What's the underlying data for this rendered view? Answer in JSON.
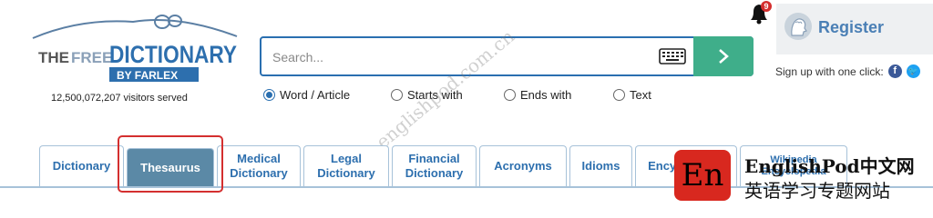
{
  "header": {
    "logo": {
      "line1": "THE",
      "line2": "FREE",
      "line3": "DICTIONARY",
      "line4": "BY FARLEX"
    },
    "visitors": "12,500,072,207 visitors served"
  },
  "search": {
    "placeholder": "Search...",
    "value": "",
    "go_icon": "chevron-right-icon",
    "keyboard_icon": "keyboard-icon"
  },
  "search_modes": [
    {
      "label": "Word / Article",
      "selected": true
    },
    {
      "label": "Starts with",
      "selected": false
    },
    {
      "label": "Ends with",
      "selected": false
    },
    {
      "label": "Text",
      "selected": false
    }
  ],
  "notifications": {
    "count": "9"
  },
  "account": {
    "register_label": "Register",
    "signup_text": "Sign up with one click:"
  },
  "tabs": [
    {
      "label": "Dictionary",
      "active": false
    },
    {
      "label": "Thesaurus",
      "active": true
    },
    {
      "label": "Medical Dictionary",
      "active": false
    },
    {
      "label": "Legal Dictionary",
      "active": false
    },
    {
      "label": "Financial Dictionary",
      "active": false
    },
    {
      "label": "Acronyms",
      "active": false
    },
    {
      "label": "Idioms",
      "active": false
    },
    {
      "label": "Encyclopedia",
      "active": false
    },
    {
      "label": "Wikipedia Encyclopedia",
      "active": false
    }
  ],
  "watermark": {
    "diagonal": "englishpod.com.cn",
    "logo": "En",
    "title": "EnglishPod中文网",
    "subtitle": "英语学习专题网站"
  },
  "colors": {
    "accent": "#2d6fae",
    "go_button": "#3fae8a",
    "active_tab": "#5b89a6",
    "highlight": "#d42f2f"
  }
}
